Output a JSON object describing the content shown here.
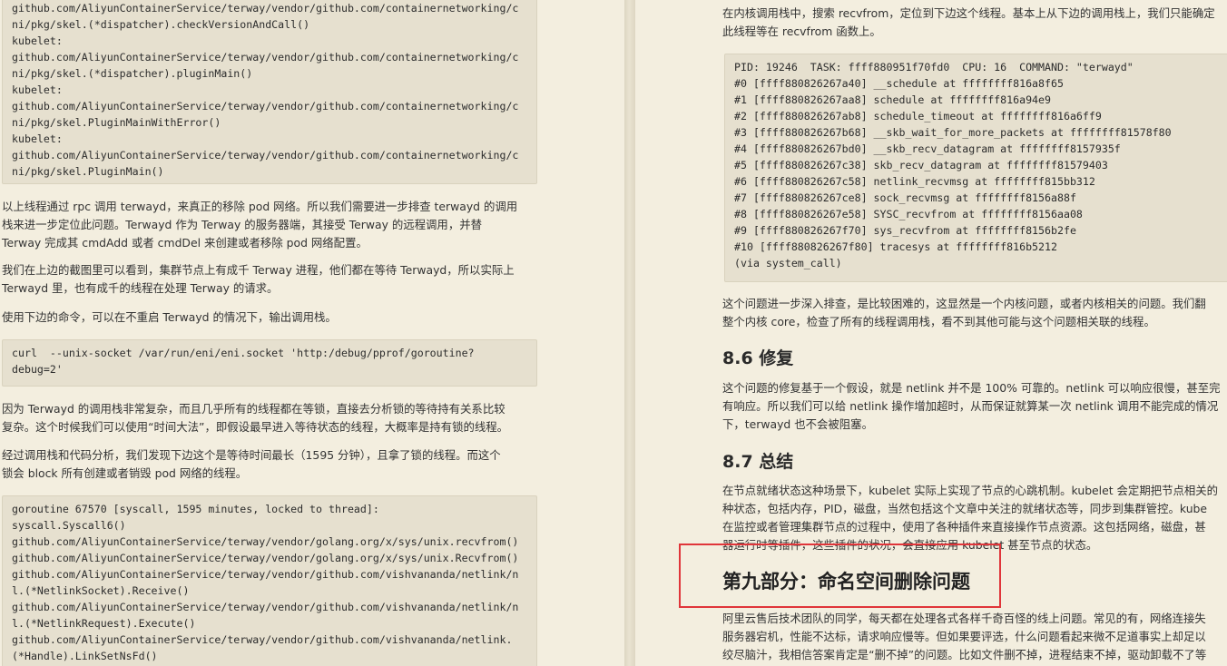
{
  "left": {
    "code1": [
      "github.com/AliyunContainerService/terway/vendor/github.com/containernetworking/c",
      "ni/pkg/skel.(*dispatcher).checkVersionAndCall()",
      "kubelet:",
      "github.com/AliyunContainerService/terway/vendor/github.com/containernetworking/c",
      "ni/pkg/skel.(*dispatcher).pluginMain()",
      "kubelet:",
      "github.com/AliyunContainerService/terway/vendor/github.com/containernetworking/c",
      "ni/pkg/skel.PluginMainWithError()",
      "kubelet:",
      "github.com/AliyunContainerService/terway/vendor/github.com/containernetworking/c",
      "ni/pkg/skel.PluginMain()"
    ],
    "para1": [
      "以上线程通过 rpc 调用 terwayd，来真正的移除 pod 网络。所以我们需要进一步排查 terwayd 的调用",
      "栈来进一步定位此问题。Terwayd 作为 Terway 的服务器端，其接受 Terway 的远程调用，并替",
      "Terway 完成其 cmdAdd 或者 cmdDel 来创建或者移除 pod 网络配置。"
    ],
    "para2": [
      "我们在上边的截图里可以看到，集群节点上有成千 Terway 进程，他们都在等待 Terwayd，所以实际上",
      "Terwayd 里，也有成千的线程在处理 Terway 的请求。"
    ],
    "para3": [
      "使用下边的命令，可以在不重启 Terwayd 的情况下，输出调用栈。"
    ],
    "code2": [
      "curl  --unix-socket /var/run/eni/eni.socket 'http:/debug/pprof/goroutine?",
      "debug=2'"
    ],
    "para4": [
      "因为 Terwayd 的调用栈非常复杂，而且几乎所有的线程都在等锁，直接去分析锁的等待持有关系比较",
      "复杂。这个时候我们可以使用“时间大法”，即假设最早进入等待状态的线程，大概率是持有锁的线程。"
    ],
    "para5": [
      "经过调用栈和代码分析，我们发现下边这个是等待时间最长（1595 分钟），且拿了锁的线程。而这个",
      "锁会 block 所有创建或者销毁 pod 网络的线程。"
    ],
    "code3": [
      "goroutine 67570 [syscall, 1595 minutes, locked to thread]:",
      "syscall.Syscall6()",
      "github.com/AliyunContainerService/terway/vendor/golang.org/x/sys/unix.recvfrom()",
      "github.com/AliyunContainerService/terway/vendor/golang.org/x/sys/unix.Recvfrom()",
      "github.com/AliyunContainerService/terway/vendor/github.com/vishvananda/netlink/n",
      "l.(*NetlinkSocket).Receive()",
      "github.com/AliyunContainerService/terway/vendor/github.com/vishvananda/netlink/n",
      "l.(*NetlinkRequest).Execute()",
      "github.com/AliyunContainerService/terway/vendor/github.com/vishvananda/netlink.",
      "(*Handle).LinkSetNsFd()"
    ]
  },
  "right": {
    "para1": [
      "在内核调用栈中，搜索 recvfrom，定位到下边这个线程。基本上从下边的调用栈上，我们只能确定",
      "此线程等在 recvfrom 函数上。"
    ],
    "code1": [
      "PID: 19246  TASK: ffff880951f70fd0  CPU: 16  COMMAND: \"terwayd\"",
      "#0 [ffff880826267a40] __schedule at ffffffff816a8f65",
      "#1 [ffff880826267aa8] schedule at ffffffff816a94e9",
      "#2 [ffff880826267ab8] schedule_timeout at ffffffff816a6ff9",
      "#3 [ffff880826267b68] __skb_wait_for_more_packets at ffffffff81578f80",
      "#4 [ffff880826267bd0] __skb_recv_datagram at ffffffff8157935f",
      "#5 [ffff880826267c38] skb_recv_datagram at ffffffff81579403",
      "#6 [ffff880826267c58] netlink_recvmsg at ffffffff815bb312",
      "#7 [ffff880826267ce8] sock_recvmsg at ffffffff8156a88f",
      "#8 [ffff880826267e58] SYSC_recvfrom at ffffffff8156aa08",
      "#9 [ffff880826267f70] sys_recvfrom at ffffffff8156b2fe",
      "#10 [ffff880826267f80] tracesys at ffffffff816b5212",
      "(via system_call)"
    ],
    "para2": [
      "这个问题进一步深入排查，是比较困难的，这显然是一个内核问题，或者内核相关的问题。我们翻",
      "整个内核 core，检查了所有的线程调用栈，看不到其他可能与这个问题相关联的线程。"
    ],
    "heading1": "8.6 修复",
    "para3": [
      "这个问题的修复基于一个假设，就是 netlink 并不是 100% 可靠的。netlink 可以响应很慢，甚至完",
      "有响应。所以我们可以给 netlink 操作增加超时，从而保证就算某一次 netlink 调用不能完成的情况",
      "下，terwayd 也不会被阻塞。"
    ],
    "heading2": "8.7 总结",
    "para4": [
      "在节点就绪状态这种场景下，kubelet 实际上实现了节点的心跳机制。kubelet 会定期把节点相关的",
      "种状态，包括内存，PID，磁盘，当然包括这个文章中关注的就绪状态等，同步到集群管控。kube",
      "在监控或者管理集群节点的过程中，使用了各种插件来直接操作节点资源。这包括网络，磁盘，甚",
      "器运行时等插件，这些插件的状况，会直接应用 kubelet 甚至节点的状态。"
    ],
    "heading3": "第九部分：命名空间删除问题",
    "para5": [
      "阿里云售后技术团队的同学，每天都在处理各式各样千奇百怪的线上问题。常见的有，网络连接失",
      "服务器宕机，性能不达标，请求响应慢等。但如果要评选，什么问题看起来微不足道事实上却足以",
      "绞尽脑汁，我相信答案肯定是“删不掉”的问题。比如文件删不掉，进程结束不掉，驱动卸载不了等"
    ]
  },
  "colors": {
    "highlight_box": "#e0353a",
    "page_background": "#f3eedf",
    "code_background": "#e6e0cf"
  }
}
